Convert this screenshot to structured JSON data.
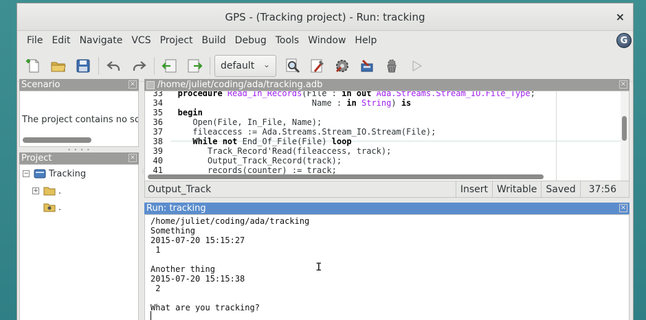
{
  "window": {
    "title": "GPS - (Tracking project) - Run: tracking",
    "close_glyph": "×"
  },
  "menubar": {
    "items": [
      "File",
      "Edit",
      "Navigate",
      "VCS",
      "Project",
      "Build",
      "Debug",
      "Tools",
      "Window",
      "Help"
    ],
    "right_icon": "gps-logo-icon"
  },
  "toolbar": {
    "build_mode": "default",
    "icons": [
      "new-file-icon",
      "open-folder-icon",
      "save-icon",
      "undo-icon",
      "redo-icon",
      "back-icon",
      "forward-icon",
      "search-icon",
      "compile-icon",
      "build-icon",
      "build-all-icon",
      "clean-icon",
      "run-icon"
    ]
  },
  "scenario": {
    "title": "Scenario",
    "text": "The project contains no sc"
  },
  "project": {
    "title": "Project",
    "root": "Tracking",
    "children": [
      ".",
      "."
    ]
  },
  "editor": {
    "title": "/home/juliet/coding/ada/tracking.adb",
    "lines": [
      {
        "n": "33",
        "parts": [
          [
            "kw",
            "   procedure "
          ],
          [
            "ty",
            "Read_In_Records"
          ],
          [
            "",
            "(File : "
          ],
          [
            "kw",
            "in out "
          ],
          [
            "ty",
            "Ada.Streams.Stream_IO.File_Type"
          ],
          [
            "",
            ";"
          ]
        ]
      },
      {
        "n": "34",
        "parts": [
          [
            "",
            "                              Name : "
          ],
          [
            "kw",
            "in "
          ],
          [
            "ty",
            "String"
          ],
          [
            "",
            ") "
          ],
          [
            "kw",
            "is"
          ]
        ]
      },
      {
        "n": "35",
        "parts": [
          [
            "kw",
            "   begin"
          ]
        ]
      },
      {
        "n": "36",
        "parts": [
          [
            "",
            "      Open(File, In_File, Name);"
          ]
        ]
      },
      {
        "n": "37",
        "parts": [
          [
            "",
            "      fileaccess := Ada.Streams.Stream_IO.Stream(File);"
          ]
        ]
      },
      {
        "n": "38",
        "parts": [
          [
            "kw",
            "      While not "
          ],
          [
            "",
            "End_Of_File(File) "
          ],
          [
            "kw",
            "loop"
          ]
        ]
      },
      {
        "n": "39",
        "parts": [
          [
            "",
            "         Track_Record'Read(fileaccess, track);"
          ]
        ]
      },
      {
        "n": "40",
        "parts": [
          [
            "",
            "         Output_Track_Record(track);"
          ]
        ]
      },
      {
        "n": "41",
        "parts": [
          [
            "",
            "         records(counter) := track;"
          ]
        ]
      }
    ],
    "status": {
      "entity": "Output_Track",
      "mode": "Insert",
      "writable": "Writable",
      "saved": "Saved",
      "position": "37:56"
    }
  },
  "run": {
    "title": "Run: tracking",
    "lines": [
      "/home/juliet/coding/ada/tracking",
      "Something",
      "2015-07-20 15:15:27",
      " 1",
      "",
      "Another thing",
      "2015-07-20 15:15:38",
      " 2",
      "",
      "What are you tracking?"
    ],
    "ibeam": "I"
  }
}
